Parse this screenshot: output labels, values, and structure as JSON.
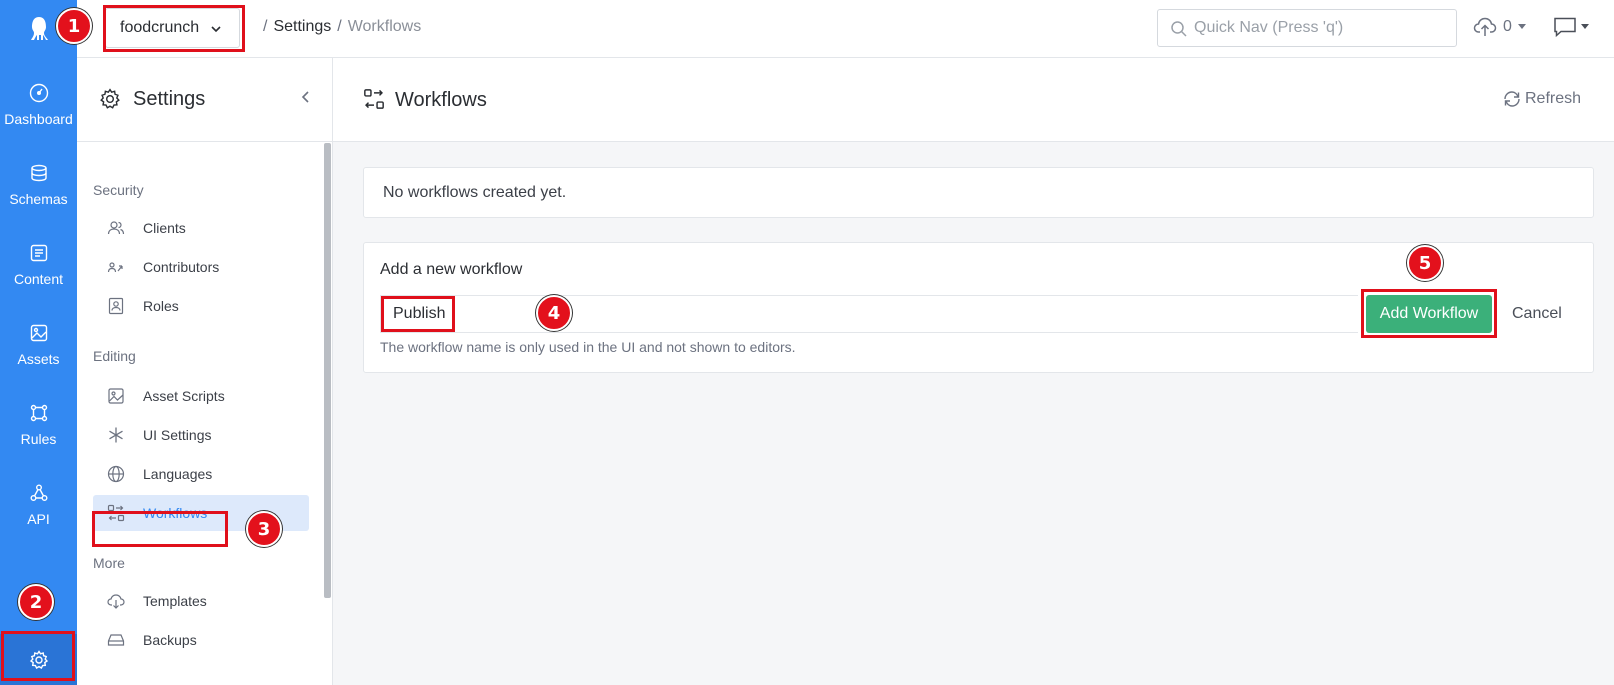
{
  "rail": {
    "items": [
      {
        "label": "Dashboard",
        "icon": "dashboard-icon"
      },
      {
        "label": "Schemas",
        "icon": "schemas-icon"
      },
      {
        "label": "Content",
        "icon": "content-icon"
      },
      {
        "label": "Assets",
        "icon": "assets-icon"
      },
      {
        "label": "Rules",
        "icon": "rules-icon"
      },
      {
        "label": "API",
        "icon": "api-icon"
      }
    ],
    "settings_icon": "gear-icon"
  },
  "topbar": {
    "app_name": "foodcrunch",
    "breadcrumb": {
      "sep1": "/",
      "settings": "Settings",
      "sep2": "/",
      "current": "Workflows"
    },
    "quicknav_placeholder": "Quick Nav (Press 'q')",
    "upload_count": "0"
  },
  "settings_panel": {
    "title": "Settings",
    "sections": {
      "security": "Security",
      "editing": "Editing",
      "more": "More"
    },
    "items": {
      "clients": "Clients",
      "contributors": "Contributors",
      "roles": "Roles",
      "asset_scripts": "Asset Scripts",
      "ui_settings": "UI Settings",
      "languages": "Languages",
      "workflows": "Workflows",
      "templates": "Templates",
      "backups": "Backups"
    }
  },
  "main": {
    "title": "Workflows",
    "refresh_label": "Refresh",
    "empty_message": "No workflows created yet.",
    "add_form": {
      "title": "Add a new workflow",
      "name_value": "Publish",
      "add_button": "Add Workflow",
      "cancel": "Cancel",
      "hint": "The workflow name is only used in the UI and not shown to editors."
    }
  },
  "annotations": [
    "1",
    "2",
    "3",
    "4",
    "5"
  ],
  "colors": {
    "rail": "#3389f2",
    "add_button": "#3bb07a",
    "annotation": "#e3111c",
    "active_nav_bg": "#dde9fb"
  }
}
